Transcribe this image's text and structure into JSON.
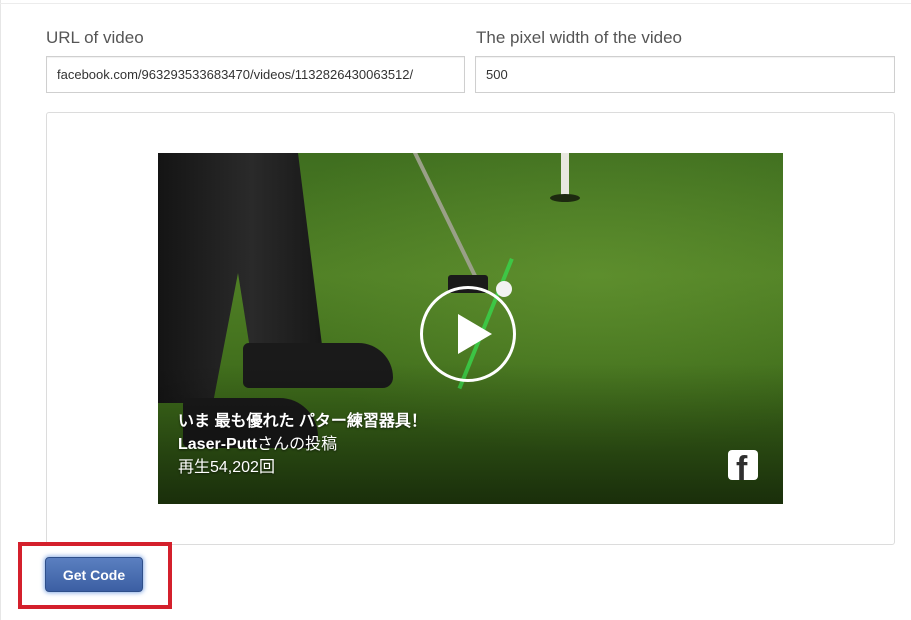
{
  "form": {
    "url_label": "URL of video",
    "url_value": "facebook.com/963293533683470/videos/1132826430063512/",
    "width_label": "The pixel width of the video",
    "width_value": "500"
  },
  "video": {
    "title": "いま 最も優れた パター練習器具！",
    "author_name": "Laser-Putt",
    "author_suffix": "さんの投稿",
    "views": "再生54,202回",
    "play_icon": "play-icon",
    "brand_icon": "facebook-icon"
  },
  "actions": {
    "get_code_label": "Get Code"
  },
  "colors": {
    "highlight": "#d4202c",
    "button": "#3c5fa3"
  }
}
